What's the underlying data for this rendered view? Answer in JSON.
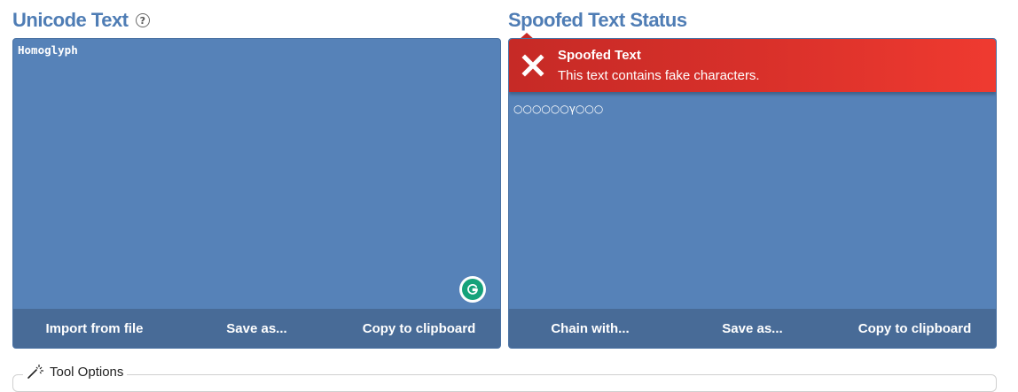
{
  "left_panel": {
    "title": "Unicode Text",
    "help_icon": "?",
    "input_text": "Homoglyph",
    "actions": [
      "Import from file",
      "Save as...",
      "Copy to clipboard"
    ]
  },
  "right_panel": {
    "title": "Spoofed Text Status",
    "alert": {
      "title": "Spoofed Text",
      "message": "This text contains fake characters."
    },
    "output_text": "○○○○○○γ○○○",
    "actions": [
      "Chain with...",
      "Save as...",
      "Copy to clipboard"
    ]
  },
  "tool_options": {
    "label": "Tool Options"
  },
  "colors": {
    "title": "#4f7db5",
    "panel_bg": "#5682b8",
    "action_bar_bg": "#486b97",
    "alert_bg": "#d8302a",
    "grammarly": "#15a27a"
  },
  "icons": {
    "help": "question-circle-icon",
    "alert": "close-x-icon",
    "grammarly": "grammarly-icon",
    "tool_options": "magic-wand-icon"
  }
}
